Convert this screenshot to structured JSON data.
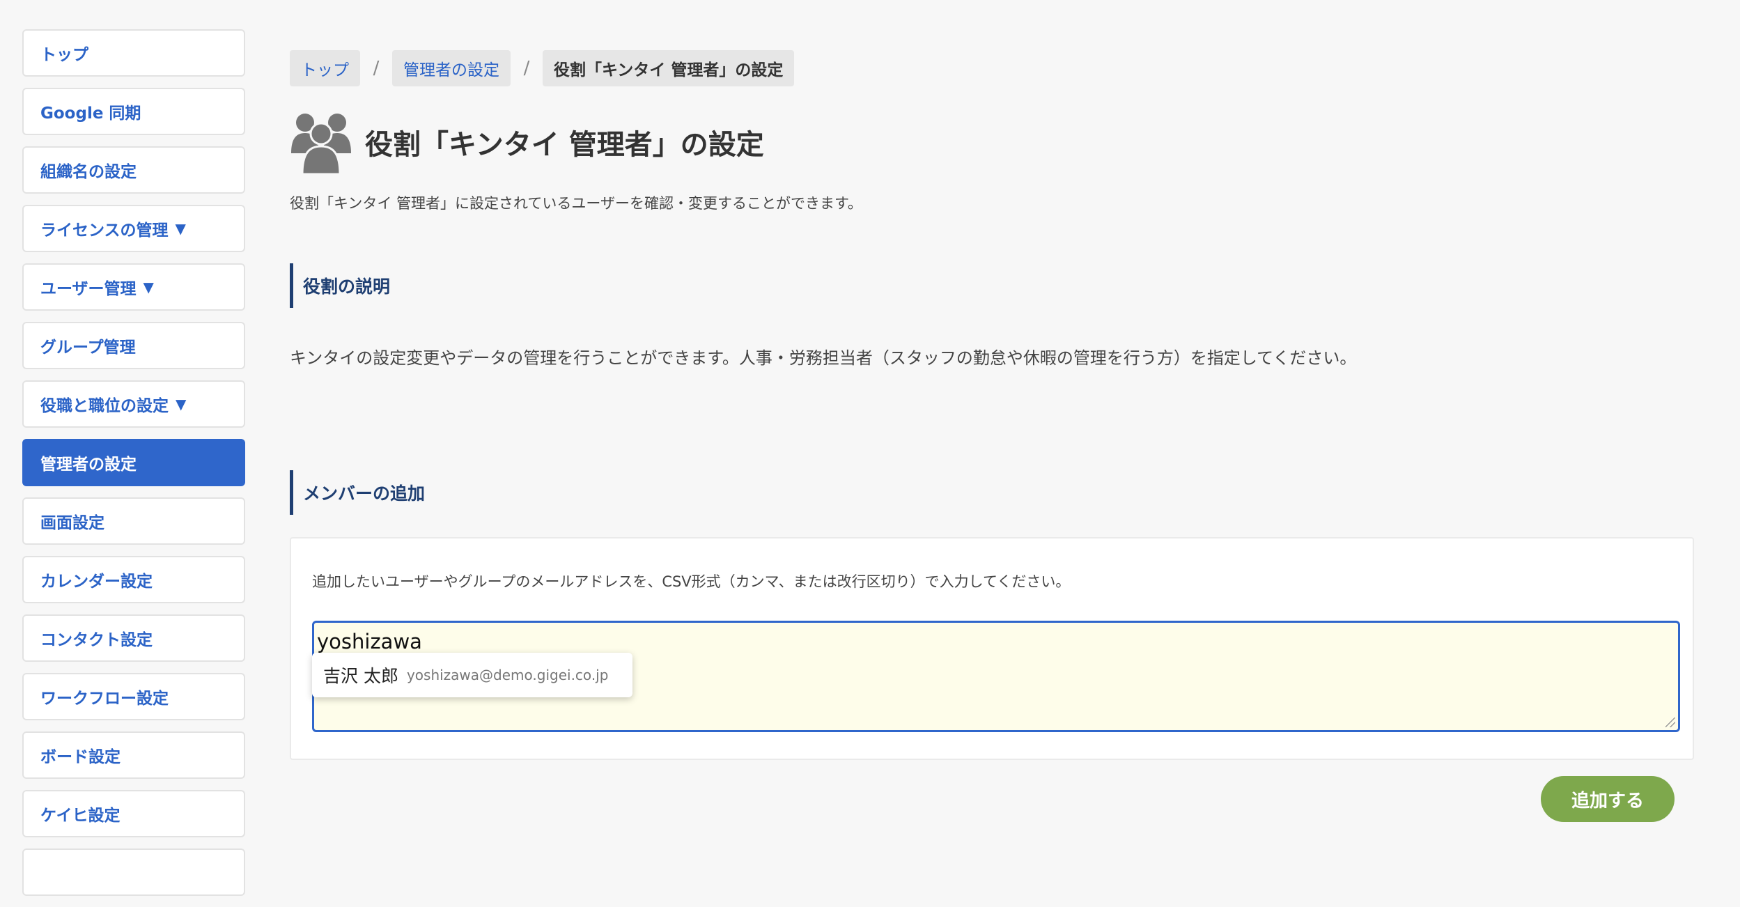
{
  "sidebar": {
    "items": [
      {
        "label": "トップ",
        "caret": ""
      },
      {
        "label": "Google 同期",
        "caret": ""
      },
      {
        "label": "組織名の設定",
        "caret": ""
      },
      {
        "label": "ライセンスの管理",
        "caret": "▼"
      },
      {
        "label": "ユーザー管理",
        "caret": "▼"
      },
      {
        "label": "グループ管理",
        "caret": ""
      },
      {
        "label": "役職と職位の設定",
        "caret": "▼"
      },
      {
        "label": "管理者の設定",
        "caret": "",
        "active": true
      },
      {
        "label": "画面設定",
        "caret": ""
      },
      {
        "label": "カレンダー設定",
        "caret": ""
      },
      {
        "label": "コンタクト設定",
        "caret": ""
      },
      {
        "label": "ワークフロー設定",
        "caret": ""
      },
      {
        "label": "ボード設定",
        "caret": ""
      },
      {
        "label": "ケイヒ設定",
        "caret": ""
      }
    ]
  },
  "breadcrumb": {
    "top": "トップ",
    "admin": "管理者の設定",
    "current": "役割「キンタイ 管理者」の設定",
    "separator": "/"
  },
  "page": {
    "title": "役割「キンタイ 管理者」の設定",
    "description": "役割「キンタイ 管理者」に設定されているユーザーを確認・変更することができます。",
    "icon": "users-group-icon"
  },
  "role_section": {
    "heading": "役割の説明",
    "text": "キンタイの設定変更やデータの管理を行うことができます。人事・労務担当者（スタッフの勤怠や休暇の管理を行う方）を指定してください。"
  },
  "member_section": {
    "heading": "メンバーの追加",
    "instruction": "追加したいユーザーやグループのメールアドレスを、CSV形式（カンマ、または改行区切り）で入力してください。",
    "input_value": "yoshizawa",
    "suggestion": {
      "name": "吉沢 太郎",
      "email": "yoshizawa@demo.gigei.co.jp"
    },
    "add_button": "追加する"
  },
  "colors": {
    "accent": "#2f66cb",
    "heading": "#1f3f72",
    "button": "#7ea84c",
    "input_bg": "#fefdea"
  }
}
